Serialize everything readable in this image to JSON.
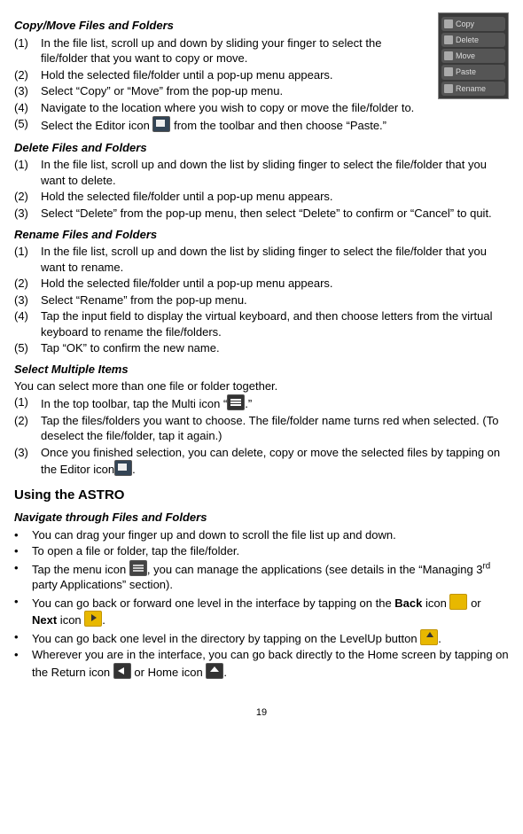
{
  "popup": {
    "items": [
      "Copy",
      "Delete",
      "Move",
      "Paste",
      "Rename"
    ]
  },
  "sec1": {
    "title": "Copy/Move Files and Folders",
    "s1n": "(1)",
    "s1": "In the file list, scroll up and down by sliding your finger to select the file/folder that you want to copy or move.",
    "s2n": "(2)",
    "s2": "Hold the selected file/folder until a pop-up menu appears.",
    "s3n": "(3)",
    "s3": "Select “Copy” or “Move” from the pop-up menu.",
    "s4n": "(4)",
    "s4": "Navigate to the location where you wish to copy or move the file/folder to.",
    "s5n": "(5)",
    "s5a": "Select the Editor icon ",
    "s5b": " from the toolbar and then choose “Paste.”"
  },
  "sec2": {
    "title": "Delete Files and Folders",
    "s1n": "(1)",
    "s1": "In the file list, scroll up and down the list by sliding finger to select the file/folder that you want to delete.",
    "s2n": "(2)",
    "s2": "Hold the selected file/folder until a pop-up menu appears.",
    "s3n": "(3)",
    "s3": "Select “Delete” from the pop-up menu, then select “Delete” to confirm or “Cancel” to quit."
  },
  "sec3": {
    "title": "Rename Files and Folders",
    "s1n": "(1)",
    "s1": "In the file list, scroll up and down the list by sliding finger to select the file/folder that you want to rename.",
    "s2n": "(2)",
    "s2": "Hold the selected file/folder until a pop-up menu appears.",
    "s3n": "(3)",
    "s3": "Select “Rename” from the pop-up menu.",
    "s4n": "(4)",
    "s4": "Tap the input field to display the virtual keyboard, and then choose letters from the virtual keyboard to rename the file/folders.",
    "s5n": "(5)",
    "s5": "Tap “OK” to confirm the new name."
  },
  "sec4": {
    "title": "Select Multiple Items",
    "intro": "You can select more than one file or folder together.",
    "s1n": "(1)",
    "s1a": "In the top toolbar, tap the Multi icon “",
    "s1b": ".”",
    "s2n": "(2)",
    "s2": "Tap the files/folders you want to choose. The file/folder name turns red when selected. (To deselect the file/folder, tap it again.)",
    "s3n": "(3)",
    "s3a": "Once you finished selection, you can delete, copy or move the selected files by tapping on the Editor icon",
    "s3b": "."
  },
  "h2": "Using the ASTRO",
  "sec5": {
    "title": "Navigate through Files and Folders",
    "bullet": "•",
    "b1": "You can drag your finger up and down to scroll the file list up and down.",
    "b2": "To open a file or folder, tap the file/folder.",
    "b3a": "Tap the menu icon ",
    "b3b": ", you can manage the applications (see details in the “Managing 3",
    "b3sup": "rd",
    "b3c": " party Applications” section).",
    "b4a": "You can go back or forward one level in the interface by tapping on the ",
    "b4bold1": "Back",
    "b4b": " icon ",
    "b4c": " or ",
    "b4bold2": "Next",
    "b4d": " icon ",
    "b4e": ".",
    "b5a": "You can go back one level in the directory by tapping on the LevelUp button ",
    "b5b": ".",
    "b6a": "Wherever you are in the interface, you can go back directly to the Home screen by tapping on the Return icon ",
    "b6b": " or Home icon ",
    "b6c": "."
  },
  "page": "19"
}
